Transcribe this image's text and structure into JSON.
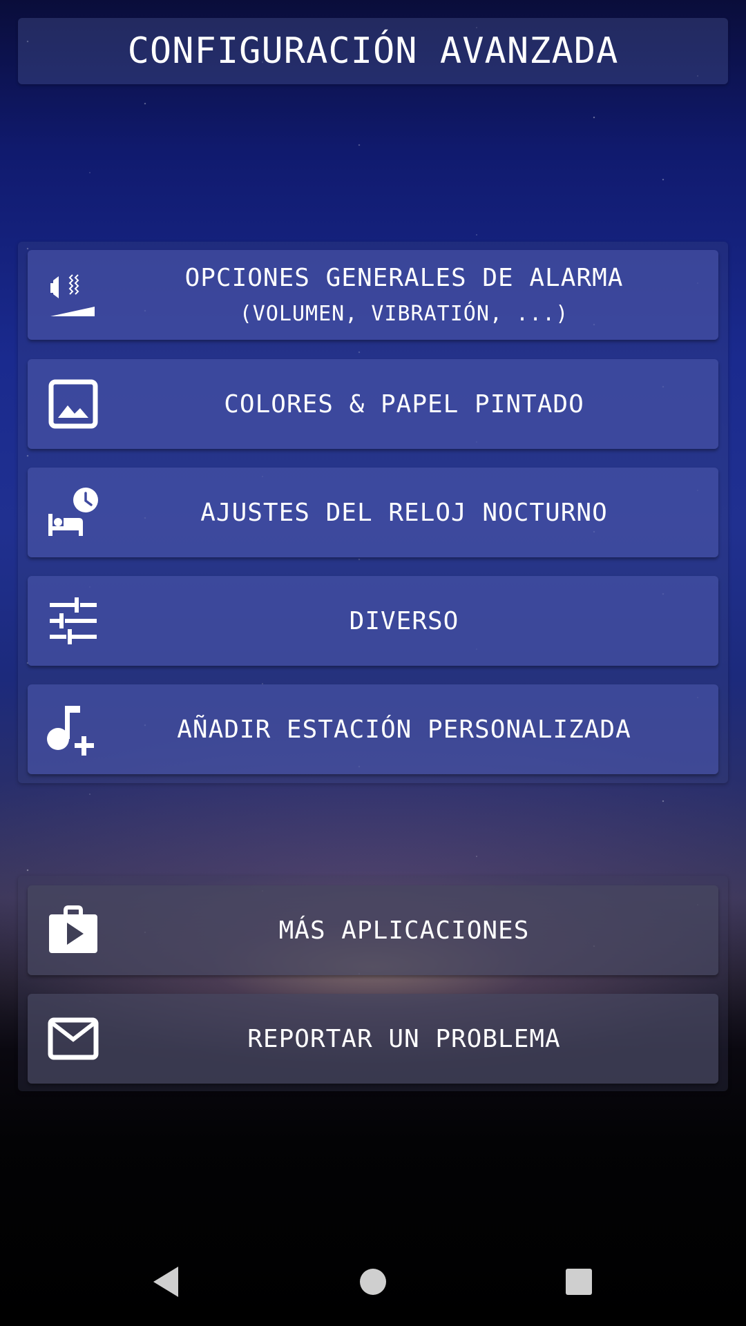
{
  "header": {
    "title": "CONFIGURACIÓN AVANZADA"
  },
  "menu": {
    "items": [
      {
        "label": "OPCIONES GENERALES DE ALARMA",
        "sublabel": "(VOLUMEN, VIBRATIÓN, ...)",
        "icon": "volume-vibration-icon"
      },
      {
        "label": "COLORES & PAPEL PINTADO",
        "icon": "image-icon"
      },
      {
        "label": "AJUSTES DEL RELOJ NOCTURNO",
        "icon": "bed-clock-icon"
      },
      {
        "label": "DIVERSO",
        "icon": "sliders-icon"
      },
      {
        "label": "AÑADIR ESTACIÓN PERSONALIZADA",
        "icon": "music-add-icon"
      }
    ]
  },
  "extra": {
    "items": [
      {
        "label": "MÁS APLICACIONES",
        "icon": "store-bag-icon"
      },
      {
        "label": "REPORTAR UN PROBLEMA",
        "icon": "mail-icon"
      }
    ]
  },
  "navigation": {
    "buttons": [
      "back-icon",
      "home-icon",
      "recents-icon"
    ],
    "color": "#cfcfcf"
  },
  "colors": {
    "button": "#4b55aa",
    "text": "#ffffff"
  }
}
